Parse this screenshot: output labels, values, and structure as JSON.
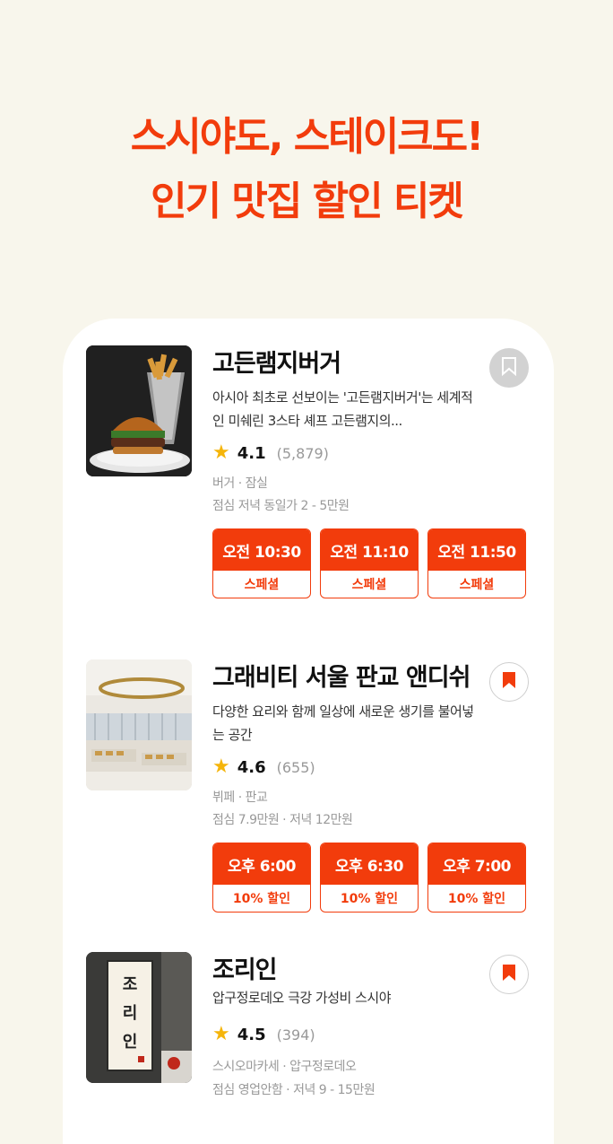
{
  "headline": {
    "line1": "스시야도, 스테이크도!",
    "line2": "인기 맛집 할인 티켓"
  },
  "colors": {
    "accent": "#f23c0c",
    "star": "#f5b50b",
    "background": "#f8f6ec"
  },
  "restaurants": [
    {
      "name": "고든램지버거",
      "description": "아시아 최초로 선보이는 '고든램지버거'는 세계적인 미쉐린 3스타 셰프 고든램지의...",
      "rating": "4.1",
      "reviews": "(5,879)",
      "category": "버거 · 잠실",
      "price": "점심 저녁 동일가 2 - 5만원",
      "bookmarked": false,
      "bookmark_icon": "bookmark-outline-icon",
      "slots": [
        {
          "time": "오전 10:30",
          "tag": "스페셜"
        },
        {
          "time": "오전 11:10",
          "tag": "스페셜"
        },
        {
          "time": "오전 11:50",
          "tag": "스페셜"
        }
      ]
    },
    {
      "name": "그래비티 서울 판교 앤디쉬",
      "description": "다양한 요리와 함께 일상에 새로운 생기를 불어넣는 공간",
      "rating": "4.6",
      "reviews": "(655)",
      "category": "뷔페 · 판교",
      "price": "점심 7.9만원 · 저녁 12만원",
      "bookmarked": true,
      "bookmark_icon": "bookmark-filled-icon",
      "slots": [
        {
          "time": "오후 6:00",
          "tag": "10% 할인"
        },
        {
          "time": "오후 6:30",
          "tag": "10% 할인"
        },
        {
          "time": "오후 7:00",
          "tag": "10% 할인"
        }
      ]
    },
    {
      "name": "조리인",
      "description": "압구정로데오 극강 가성비 스시야",
      "rating": "4.5",
      "reviews": "(394)",
      "category": "스시오마카세 · 압구정로데오",
      "price": "점심 영업안함 · 저녁 9 - 15만원",
      "bookmarked": true,
      "bookmark_icon": "bookmark-filled-icon",
      "sign_text": [
        "조",
        "리",
        "인"
      ],
      "slots": []
    }
  ]
}
